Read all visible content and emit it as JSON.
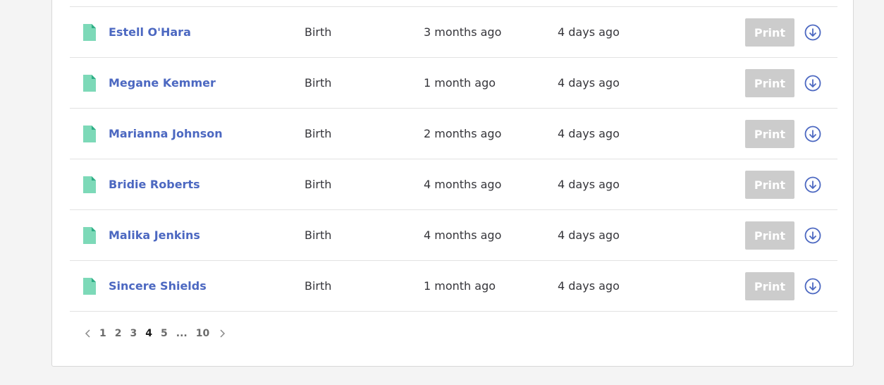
{
  "colors": {
    "link": "#4c68c1",
    "doc_icon": "#7dd9b8",
    "doc_icon_fold": "#2fae86",
    "print_button_disabled": "#cccccc",
    "download_icon": "#4c68c1"
  },
  "records": [
    {
      "name": "Estell O'Hara",
      "event": "Birth",
      "created": "3 months ago",
      "modified": "4 days ago",
      "print_label": "Print",
      "icon": "document-icon",
      "action_icon": "download-circle-icon"
    },
    {
      "name": "Megane Kemmer",
      "event": "Birth",
      "created": "1 month ago",
      "modified": "4 days ago",
      "print_label": "Print",
      "icon": "document-icon",
      "action_icon": "download-circle-icon"
    },
    {
      "name": "Marianna Johnson",
      "event": "Birth",
      "created": "2 months ago",
      "modified": "4 days ago",
      "print_label": "Print",
      "icon": "document-icon",
      "action_icon": "download-circle-icon"
    },
    {
      "name": "Bridie Roberts",
      "event": "Birth",
      "created": "4 months ago",
      "modified": "4 days ago",
      "print_label": "Print",
      "icon": "document-icon",
      "action_icon": "download-circle-icon"
    },
    {
      "name": "Malika Jenkins",
      "event": "Birth",
      "created": "4 months ago",
      "modified": "4 days ago",
      "print_label": "Print",
      "icon": "document-icon",
      "action_icon": "download-circle-icon"
    },
    {
      "name": "Sincere Shields",
      "event": "Birth",
      "created": "1 month ago",
      "modified": "4 days ago",
      "print_label": "Print",
      "icon": "document-icon",
      "action_icon": "download-circle-icon"
    }
  ],
  "pagination": {
    "prev_icon": "chevron-left-icon",
    "next_icon": "chevron-right-icon",
    "pages": [
      "1",
      "2",
      "3",
      "4",
      "5",
      "...",
      "10"
    ],
    "current": "4"
  }
}
